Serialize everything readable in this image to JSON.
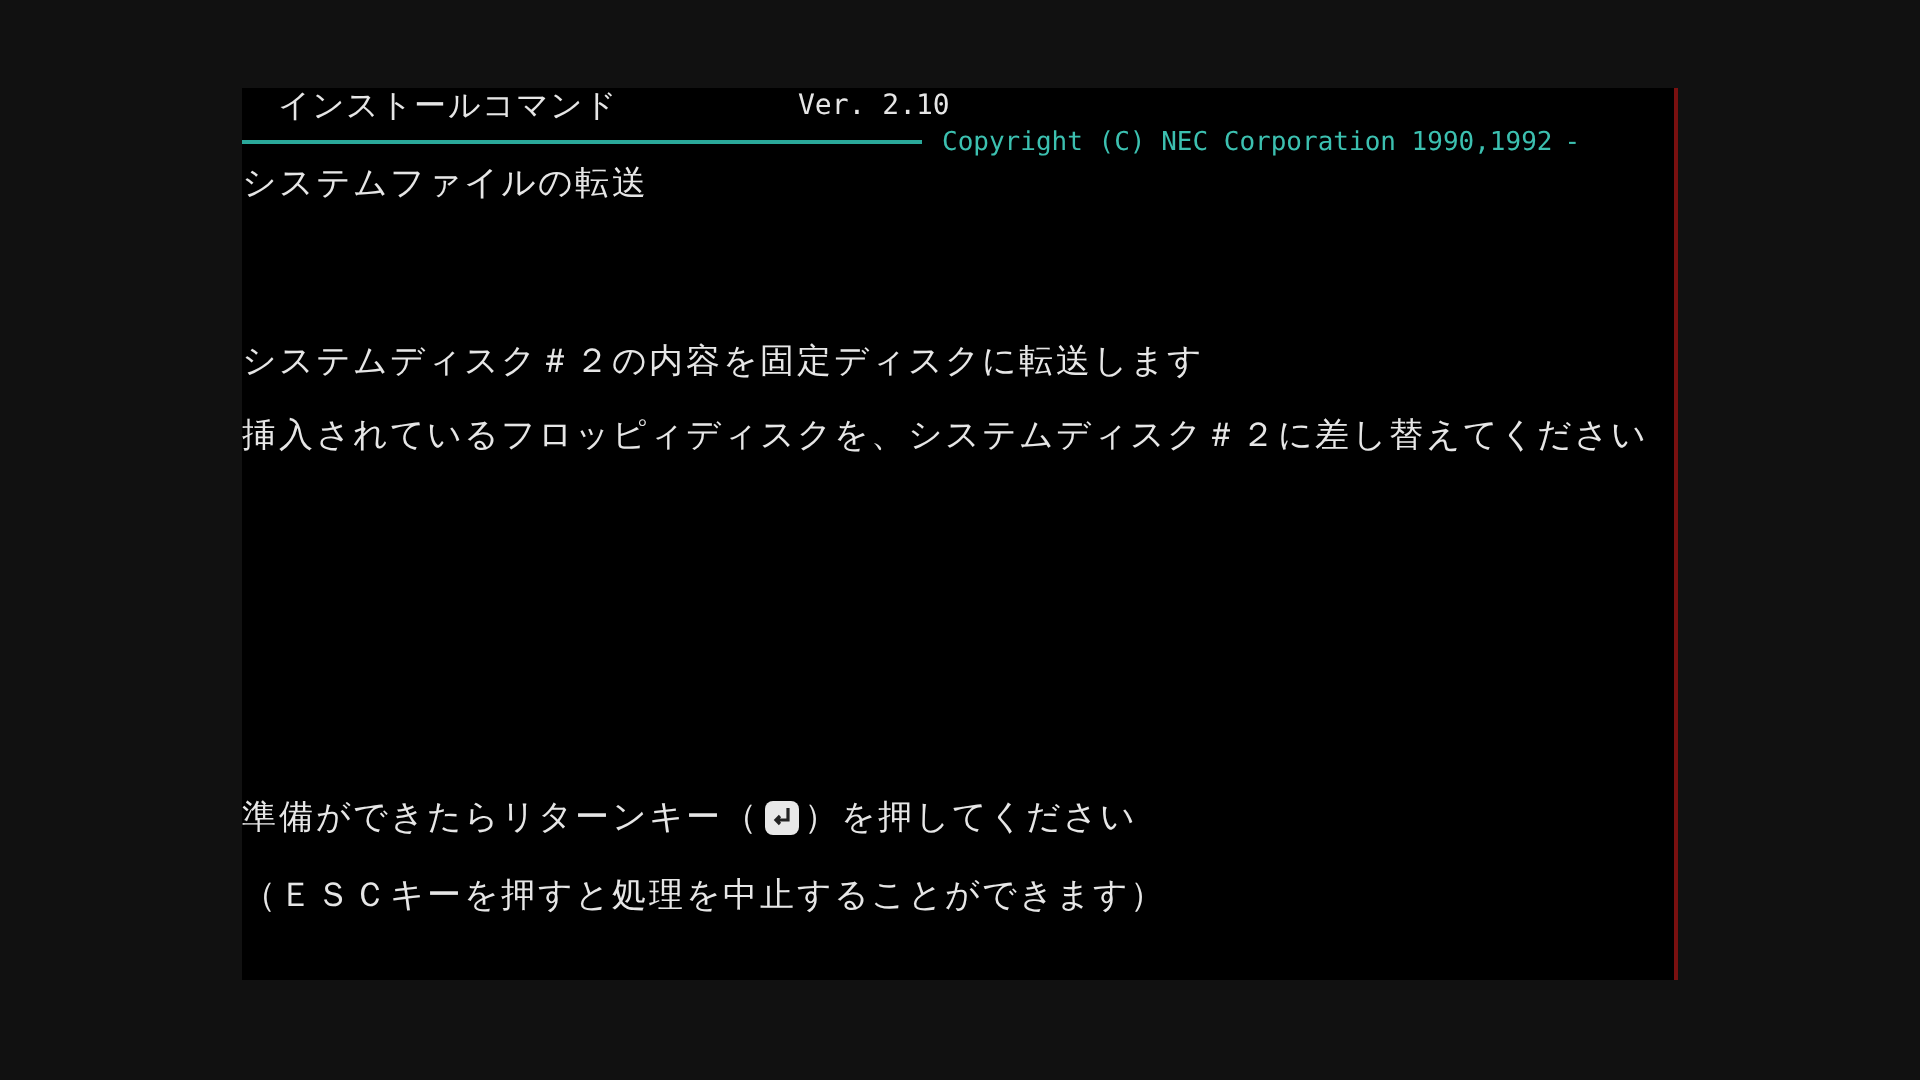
{
  "header": {
    "title": "インストールコマンド",
    "version": "Ver. 2.10",
    "copyright": "Copyright (C) NEC Corporation 1990,1992",
    "copyright_tail": "-"
  },
  "section_title": "システムファイルの転送",
  "messages": [
    "システムディスク＃２の内容を固定ディスクに転送します",
    "挿入されているフロッピィディスクを、システムディスク＃２に差し替えてください"
  ],
  "prompt": {
    "before": "準備ができたらリターンキー（",
    "after": "）を押してください"
  },
  "note": "（ＥＳＣキーを押すと処理を中止することができます）"
}
